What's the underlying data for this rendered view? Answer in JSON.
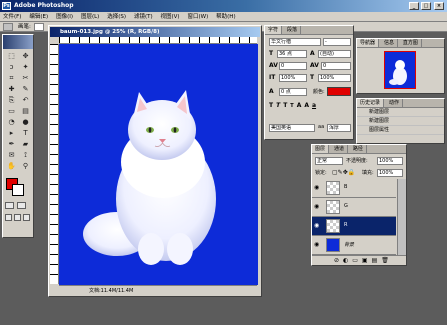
{
  "app": {
    "title": "Adobe Photoshop",
    "icon_label": "Ps"
  },
  "window_buttons": [
    "_",
    "□",
    "×"
  ],
  "menu": [
    "文件(F)",
    "编辑(E)",
    "图像(I)",
    "图层(L)",
    "选择(S)",
    "滤镜(T)",
    "视图(V)",
    "窗口(W)",
    "帮助(H)"
  ],
  "options": {
    "label": "画笔:"
  },
  "document": {
    "title": "baum-013.jpg @ 25% (R, RGB/8)",
    "status": "文档:11.4M/11.4M"
  },
  "colors": {
    "canvas_bg": "#0d2bd8",
    "foreground": "#e00000",
    "background": "#ffffff",
    "title_blue": "#0a246a"
  },
  "character": {
    "tabs": [
      "字符",
      "段落"
    ],
    "font_family": "华文行楷",
    "font_style": "-",
    "size": "36 点",
    "leading": "(自动)",
    "tracking": "0",
    "kerning": "0",
    "vscale": "100%",
    "hscale": "100%",
    "baseline": "0 点",
    "color_label": "颜色:",
    "language": "美国英语",
    "antialias": "浑厚",
    "letters": [
      "T",
      "T",
      "T",
      "T",
      "A",
      "A",
      "a"
    ]
  },
  "navigator": {
    "tabs": [
      "导航器",
      "信息",
      "直方图"
    ]
  },
  "history": {
    "tabs": [
      "历史记录",
      "动作"
    ],
    "items": [
      "新建图层",
      "新建图层",
      "图层属性"
    ]
  },
  "layers": {
    "tabs": [
      "图层",
      "通道",
      "路径"
    ],
    "blend_mode": "正常",
    "opacity_label": "不透明度:",
    "opacity": "100%",
    "lock_label": "锁定:",
    "fill_label": "填充:",
    "fill": "100%",
    "rows": [
      {
        "name": "B",
        "selected": false
      },
      {
        "name": "G",
        "selected": false
      },
      {
        "name": "R",
        "selected": true
      },
      {
        "name": "背景",
        "selected": false
      }
    ]
  },
  "icons": {
    "eye": "eye-icon",
    "tools": [
      "marquee-icon",
      "move-icon",
      "lasso-icon",
      "wand-icon",
      "crop-icon",
      "slice-icon",
      "heal-icon",
      "brush-icon",
      "stamp-icon",
      "history-brush-icon",
      "eraser-icon",
      "gradient-icon",
      "blur-icon",
      "dodge-icon",
      "path-select-icon",
      "type-icon",
      "pen-icon",
      "shape-icon",
      "notes-icon",
      "eyedropper-icon",
      "hand-icon",
      "zoom-icon"
    ],
    "tool_glyphs": [
      "⬚",
      "✥",
      "ↄ",
      "✦",
      "⌗",
      "✂",
      "✚",
      "✎",
      "⎘",
      "↶",
      "▭",
      "▤",
      "◔",
      "●",
      "▸",
      "T",
      "✒",
      "▰",
      "✉",
      "⟟",
      "✋",
      "⚲"
    ]
  }
}
